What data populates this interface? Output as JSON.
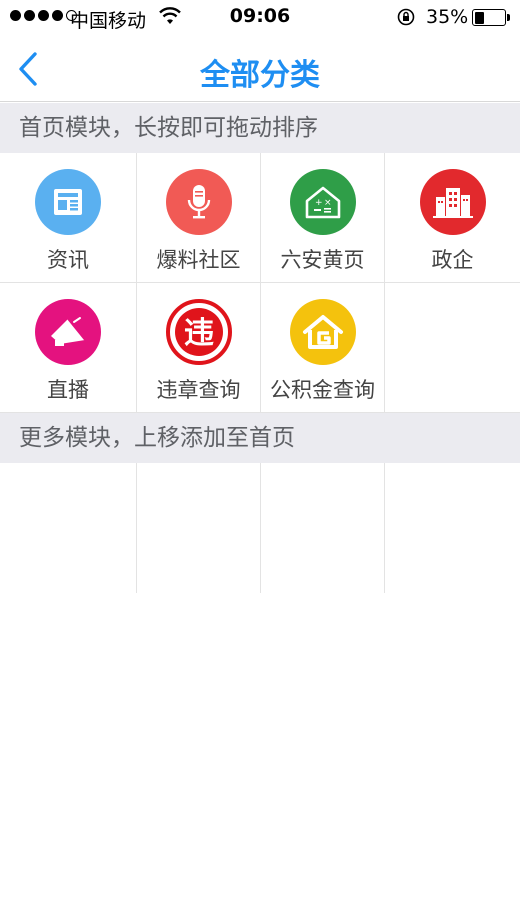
{
  "status_bar": {
    "carrier": "中国移动",
    "time": "09:06",
    "battery_percent": "35%",
    "battery_level": 0.35
  },
  "nav": {
    "title": "全部分类",
    "back_icon": "chevron-left-icon"
  },
  "home_section": {
    "header": "首页模块，长按即可拖动排序",
    "items": [
      {
        "label": "资讯",
        "icon": "news-icon",
        "color": "#5ab0f0"
      },
      {
        "label": "爆料社区",
        "icon": "microphone-icon",
        "color": "#f15a55"
      },
      {
        "label": "六安黄页",
        "icon": "house-calculator-icon",
        "color": "#2f9e48"
      },
      {
        "label": "政企",
        "icon": "buildings-icon",
        "color": "#e2292d"
      },
      {
        "label": "直播",
        "icon": "megaphone-icon",
        "color": "#e4127f"
      },
      {
        "label": "违章查询",
        "icon": "violation-icon",
        "color": "#e0141b"
      },
      {
        "label": "公积金查询",
        "icon": "housing-fund-icon",
        "color": "#f4c20d"
      }
    ]
  },
  "more_section": {
    "header": "更多模块，上移添加至首页",
    "items": []
  },
  "colors": {
    "accent": "#1e8ef2",
    "section_bg": "#ebebf0",
    "divider": "#e3e3e3"
  }
}
